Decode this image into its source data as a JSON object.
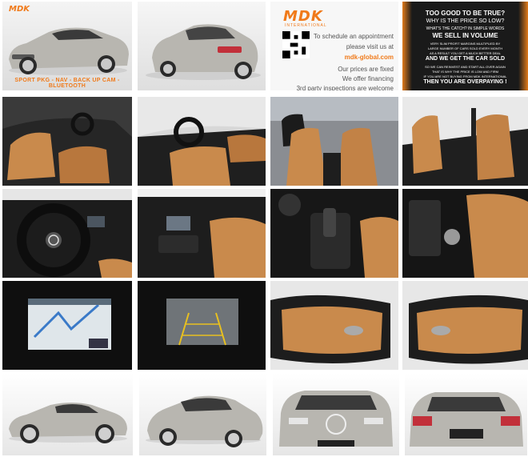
{
  "brand": {
    "logo_text": "MDK",
    "logo_sub": "INTERNATIONAL"
  },
  "tile1": {
    "caption": "SPORT PKG - NAV - BACK UP CAM - BLUETOOTH"
  },
  "promo": {
    "line1": "To schedule an appointment",
    "line2": "please visit us at",
    "link": "mdk-global.com",
    "line3": "Our prices are fixed",
    "line4": "We offer financing",
    "line5": "3rd party inspections are welcome"
  },
  "ad": {
    "headline1": "TOO GOOD TO BE TRUE?",
    "headline2": "WHY IS THE PRICE SO LOW?",
    "q": "WHAT'S THE CATCH? IN SIMPLE WORDS",
    "big": "WE SELL IN VOLUME",
    "small1": "VERY SLIM PROFIT MARGINS MULTIPLIED BY",
    "small2": "LARGE NUMBER OF CARS SOLD EVERY MONTH",
    "small3": "AS A RESULT YOU GET A MUCH BETTER DEAL",
    "big2": "AND WE GET THE CAR SOLD",
    "small4": "SO WE CAN REINVEST AND START ALL OVER AGAIN",
    "small5": "THAT IS WHY THE PRICE IS LOW AND FIRM",
    "small6": "IF YOU ARE NOT BUYING FROM MDK INTERNATIONAL",
    "big3": "THEN YOU ARE OVERPAYING !"
  },
  "colors": {
    "accent": "#f07a1a",
    "car_silver": "#b8b6b0",
    "leather": "#c98a4c",
    "interior_dark": "#1e1e1e"
  }
}
